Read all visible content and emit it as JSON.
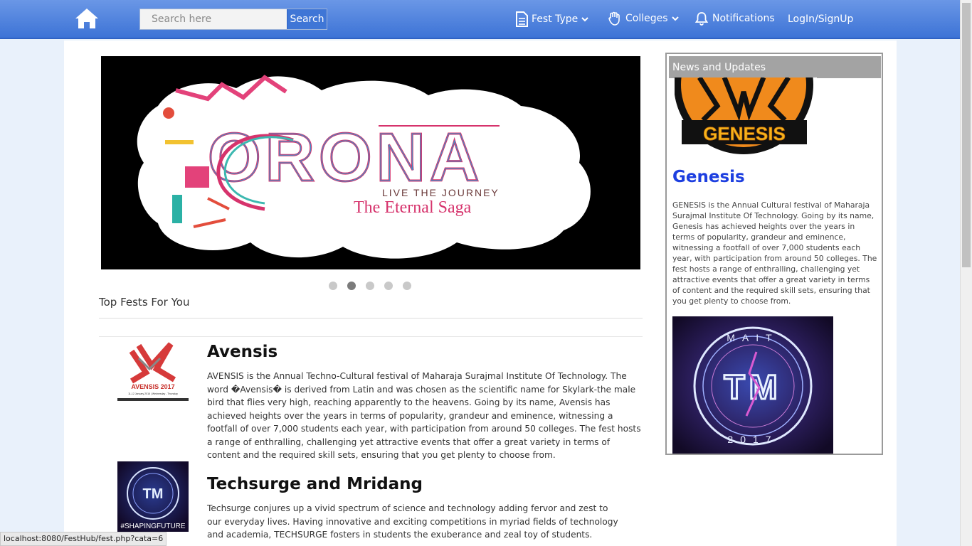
{
  "navbar": {
    "search_placeholder": "Search here",
    "search_button": "Search",
    "fest_type": "Fest Type",
    "colleges": "Colleges",
    "notifications": "Notifications",
    "login": "LogIn/SignUp"
  },
  "carousel": {
    "title": "ORONA",
    "subtitle": "LIVE THE JOURNEY",
    "tagline": "The Eternal Saga",
    "active_slide": 2,
    "slide_count": 5
  },
  "section_title": "Top Fests For You",
  "fests": [
    {
      "name": "Avensis",
      "thumb_title": "AVENSIS 2017",
      "thumb_date": "11-12 January 2016 | Wednesday - Thursday",
      "description": "AVENSIS is the Annual Techno-Cultural festival of Maharaja Surajmal Institute Of Technology. The word �Avensis� is derived from Latin and was chosen as the scientific name for Skylark-the male bird that flies very high, reaching apparently to the heavens. Going by its name, Avensis has achieved heights over the years in terms of popularity, grandeur and eminence, witnessing a footfall of over 7,000 students each year, with participation from around 50 colleges. The fest hosts a range of enthralling, challenging yet attractive events that offer a great variety in terms of content and the required skill sets, ensuring that you get plenty to choose from."
    },
    {
      "name": "Techsurge and Mridang",
      "thumb_title": "#SHAPINGFUTURE",
      "description": "Techsurge conjures up a vivid spectrum of science and technology adding fervor and zest to our everyday lives. Having innovative and exciting competitions in myriad fields of technology and academia, TECHSURGE fosters in students the exuberance and zeal toy of students."
    }
  ],
  "news": {
    "header": "News and Updates",
    "logo_text": "GENESIS",
    "title": "Genesis",
    "description": "GENESIS is the Annual Cultural festival of Maharaja Surajmal Institute Of Technology. Going by its name, Genesis has achieved heights over the years in terms of popularity, grandeur and eminence, witnessing a footfall of over 7,000 students each year, with participation from around 50 colleges. The fest hosts a range of enthralling, challenging yet attractive events that offer a great variety in terms of content and the required skill sets, ensuring that you get plenty to choose from.",
    "image2_ring_text": "MAIT",
    "image2_letters": "TM",
    "image2_year": "2017"
  },
  "status_bar": "localhost:8080/FestHub/fest.php?cata=6",
  "colors": {
    "nav_top": "#6a97e6",
    "nav_bottom": "#3d73d6",
    "news_title": "#1d3fe0",
    "news_header": "#a3a3a3"
  }
}
